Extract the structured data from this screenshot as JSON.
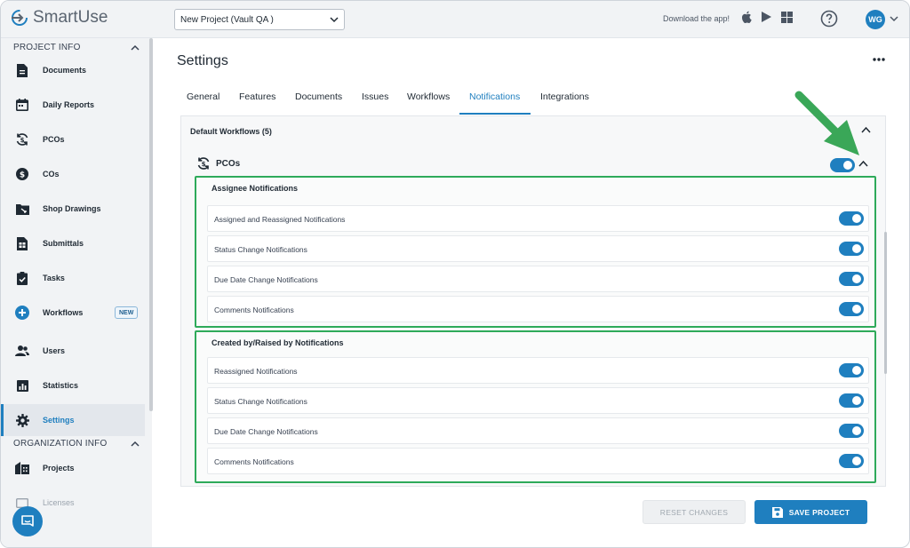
{
  "header": {
    "logo_text": "SmartUse",
    "project_select_value": "New Project (Vault QA )",
    "download_text": "Download the app!",
    "avatar_initials": "WG",
    "store_icons": [
      "apple-icon",
      "google-play-icon",
      "windows-icon"
    ]
  },
  "sidebar": {
    "project_section": "PROJECT INFO",
    "organization_section": "ORGANIZATION INFO",
    "items": [
      {
        "label": "Documents",
        "icon": "document-icon"
      },
      {
        "label": "Daily Reports",
        "icon": "calendar-icon"
      },
      {
        "label": "PCOs",
        "icon": "dollar-cycle-icon"
      },
      {
        "label": "COs",
        "icon": "dollar-icon"
      },
      {
        "label": "Shop Drawings",
        "icon": "shop-drawing-icon"
      },
      {
        "label": "Submittals",
        "icon": "submittal-icon"
      },
      {
        "label": "Tasks",
        "icon": "task-icon"
      },
      {
        "label": "Workflows",
        "icon": "plus-circle-icon",
        "badge": "NEW"
      },
      {
        "label": "Users",
        "icon": "users-icon"
      },
      {
        "label": "Statistics",
        "icon": "statistics-icon"
      },
      {
        "label": "Settings",
        "icon": "gear-icon"
      }
    ],
    "org_items": [
      {
        "label": "Projects",
        "icon": "buildings-icon"
      },
      {
        "label": "Licenses",
        "icon": "license-icon"
      }
    ]
  },
  "main": {
    "title": "Settings",
    "tabs": [
      "General",
      "Features",
      "Documents",
      "Issues",
      "Workflows",
      "Notifications",
      "Integrations"
    ],
    "active_tab": "Notifications",
    "panel_title": "Default Workflows (5)",
    "workflow_name": "PCOs",
    "workflow_enabled": true,
    "groups": [
      {
        "title": "Assignee Notifications",
        "rows": [
          {
            "label": "Assigned and Reassigned Notifications",
            "on": true
          },
          {
            "label": "Status Change Notifications",
            "on": true
          },
          {
            "label": "Due Date Change Notifications",
            "on": true
          },
          {
            "label": "Comments Notifications",
            "on": true
          }
        ]
      },
      {
        "title": "Created by/Raised by Notifications",
        "rows": [
          {
            "label": "Reassigned Notifications",
            "on": true
          },
          {
            "label": "Status Change Notifications",
            "on": true
          },
          {
            "label": "Due Date Change Notifications",
            "on": true
          },
          {
            "label": "Comments Notifications",
            "on": true
          }
        ]
      }
    ],
    "reset_label": "RESET CHANGES",
    "save_label": "SAVE PROJECT"
  },
  "colors": {
    "accent": "#1f7fbf",
    "highlight": "#2eaa5a"
  }
}
